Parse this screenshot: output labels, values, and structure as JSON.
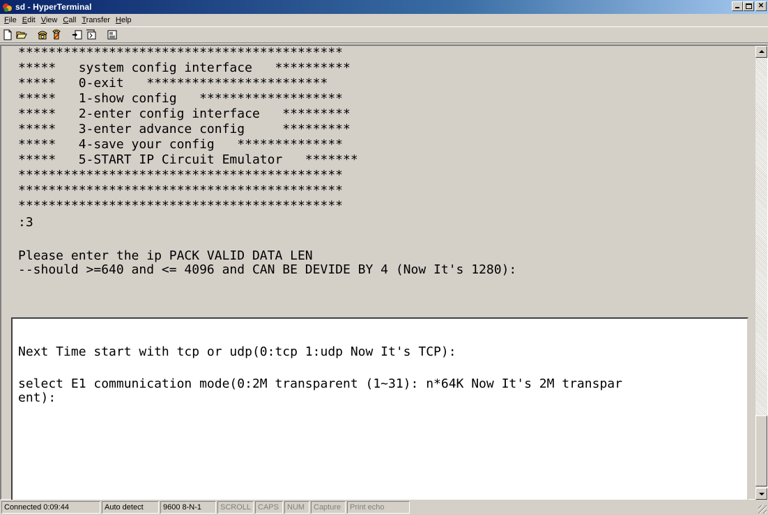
{
  "window": {
    "title": "sd - HyperTerminal"
  },
  "menu": [
    {
      "prefix": "",
      "key": "F",
      "rest": "ile"
    },
    {
      "prefix": "",
      "key": "E",
      "rest": "dit"
    },
    {
      "prefix": "",
      "key": "V",
      "rest": "iew"
    },
    {
      "prefix": "",
      "key": "C",
      "rest": "all"
    },
    {
      "prefix": "",
      "key": "T",
      "rest": "ransfer"
    },
    {
      "prefix": "",
      "key": "H",
      "rest": "elp"
    }
  ],
  "toolbar": [
    "new-icon",
    "open-icon",
    "call-icon",
    "disconnect-icon",
    "send-icon",
    "receive-icon",
    "properties-icon"
  ],
  "terminal": {
    "upper_lines": [
      "*******************************************",
      "*****   system config interface   **********",
      "*****   0-exit   ************************",
      "*****   1-show config   *******************",
      "*****   2-enter config interface   *********",
      "*****   3-enter advance config     *********",
      "*****   4-save your config   **************",
      "*****   5-START IP Circuit Emulator   *******",
      "*******************************************",
      "*******************************************",
      "*******************************************",
      ":3",
      "",
      "Please enter the ip PACK VALID DATA LEN",
      "--should >=640 and <= 4096 and CAN BE DEVIDE BY 4 (Now It's 1280):"
    ],
    "lower_lines": [
      "",
      "Next Time start with tcp or udp(0:tcp 1:udp Now It's TCP):",
      "",
      "select E1 communication mode(0:2M transparent (1~31): n*64K Now It's 2M transpar",
      "ent):"
    ]
  },
  "status": {
    "connected": "Connected 0:09:44",
    "detect": "Auto detect",
    "settings": "9600 8-N-1",
    "scroll": "SCROLL",
    "caps": "CAPS",
    "num": "NUM",
    "capture": "Capture",
    "print_echo": "Print echo"
  }
}
